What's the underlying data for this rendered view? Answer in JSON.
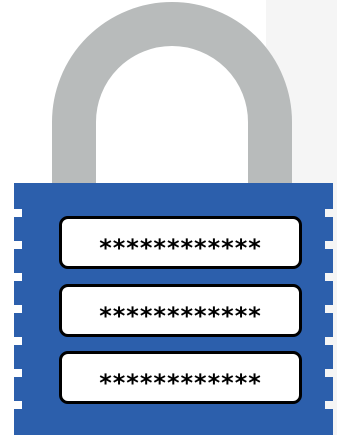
{
  "padlock": {
    "colors": {
      "body": "#2c5fac",
      "shackle": "#b8bbbb",
      "field_border": "#000000",
      "field_fill": "#ffffff"
    },
    "icon": "padlock-icon",
    "password_fields": [
      {
        "value": "************"
      },
      {
        "value": "************"
      },
      {
        "value": "************"
      }
    ]
  }
}
